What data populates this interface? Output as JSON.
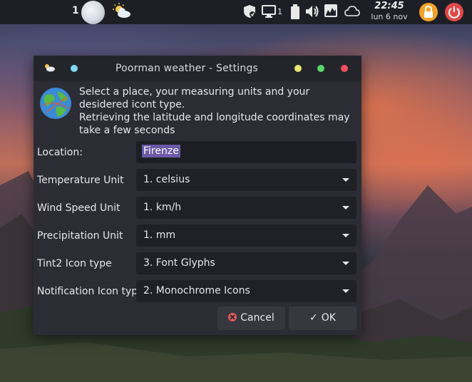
{
  "panel": {
    "desktop_number": "1",
    "tray_count": "1",
    "clock_time": "22:45",
    "clock_date": "lun 6 nov"
  },
  "dialog": {
    "title": "Poorman weather - Settings",
    "intro_line1": "Select a place, your measuring units and your desidered icont type.",
    "intro_line2": "Retrieving the latitude and longitude coordinates may take a few seconds",
    "location_label": "Location:",
    "location_value": "Firenze",
    "fields": [
      {
        "label": "Temperature Unit",
        "value": "1. celsius"
      },
      {
        "label": "Wind Speed Unit",
        "value": "1. km/h"
      },
      {
        "label": "Precipitation Unit",
        "value": "1. mm"
      },
      {
        "label": "Tint2 Icon type",
        "value": "3. Font Glyphs"
      },
      {
        "label": "Notification Icon type",
        "value": "2. Monochrome Icons"
      }
    ],
    "cancel_label": "Cancel",
    "ok_label": "OK"
  },
  "colors": {
    "panel_bg": "#1e1f26",
    "dialog_bg": "#2c2d34",
    "selection": "#6a5aa8",
    "lock": "#f2a22a",
    "power": "#e04848",
    "dot_cyan": "#7fd8f0",
    "dot_yellow": "#e8e870",
    "dot_green": "#58d868",
    "dot_red": "#f05060"
  },
  "icons": [
    "moon-icon",
    "weather-partly-cloudy-icon",
    "shield-update-icon",
    "monitor-icon",
    "battery-icon",
    "volume-icon",
    "system-monitor-icon",
    "cloud-icon",
    "lock-icon",
    "power-icon",
    "globe-icon",
    "cancel-icon",
    "checkmark-icon"
  ]
}
